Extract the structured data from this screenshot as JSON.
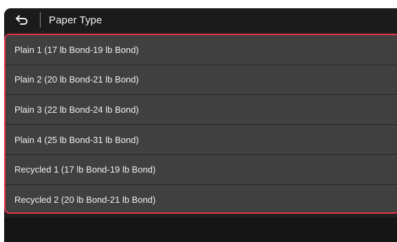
{
  "header": {
    "back_icon": "back-arrow-icon",
    "title": "Paper Type"
  },
  "list": {
    "items": [
      {
        "label": "Plain 1 (17 lb Bond-19 lb Bond)"
      },
      {
        "label": "Plain 2 (20 lb Bond-21 lb Bond)"
      },
      {
        "label": "Plain 3 (22 lb Bond-24 lb Bond)"
      },
      {
        "label": "Plain 4 (25 lb Bond-31 lb Bond)"
      },
      {
        "label": "Recycled 1 (17 lb Bond-19 lb Bond)"
      },
      {
        "label": "Recycled 2 (20 lb Bond-21 lb Bond)"
      }
    ]
  },
  "colors": {
    "highlight_border": "#e8334a",
    "item_background": "#404040",
    "screen_background": "#1f1f1f",
    "text": "#f0f0f0"
  }
}
